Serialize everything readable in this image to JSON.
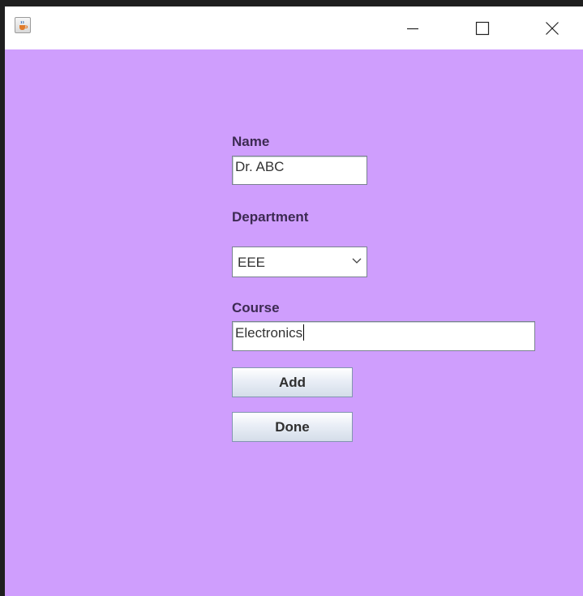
{
  "form": {
    "name_label": "Name",
    "name_value": "Dr. ABC",
    "department_label": "Department",
    "department_selected": "EEE",
    "course_label": "Course",
    "course_value": "Electronics",
    "add_label": "Add",
    "done_label": "Done"
  },
  "colors": {
    "background": "#cf9efd",
    "title_bar": "#ffffff"
  },
  "icons": {
    "app": "java-cup-icon",
    "minimize": "minimize-icon",
    "maximize": "maximize-icon",
    "close": "close-icon",
    "dropdown": "chevron-down-icon"
  }
}
